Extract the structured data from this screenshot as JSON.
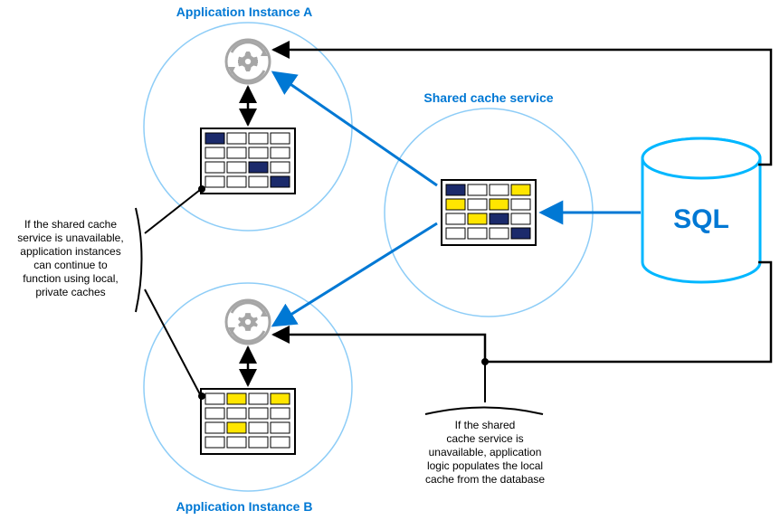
{
  "labels": {
    "appA": "Application Instance A",
    "appB": "Application Instance B",
    "sharedCache": "Shared cache service",
    "sql": "SQL",
    "note1Line1": "If the shared cache",
    "note1Line2": "service is unavailable,",
    "note1Line3": "application instances",
    "note1Line4": "can continue to",
    "note1Line5": "function using local,",
    "note1Line6": "private caches",
    "note2Line1": "If the shared",
    "note2Line2": "cache service is",
    "note2Line3": "unavailable, application",
    "note2Line4": "logic populates the local",
    "note2Line5": "cache from the database"
  },
  "colors": {
    "azureBlue": "#0078d4",
    "circleStroke": "#8ecdf7",
    "sqlStroke": "#00b7ff",
    "gearGray": "#a6a6a6",
    "cellDark": "#1b2a6b",
    "cellYellow": "#ffe600",
    "black": "#000000"
  }
}
